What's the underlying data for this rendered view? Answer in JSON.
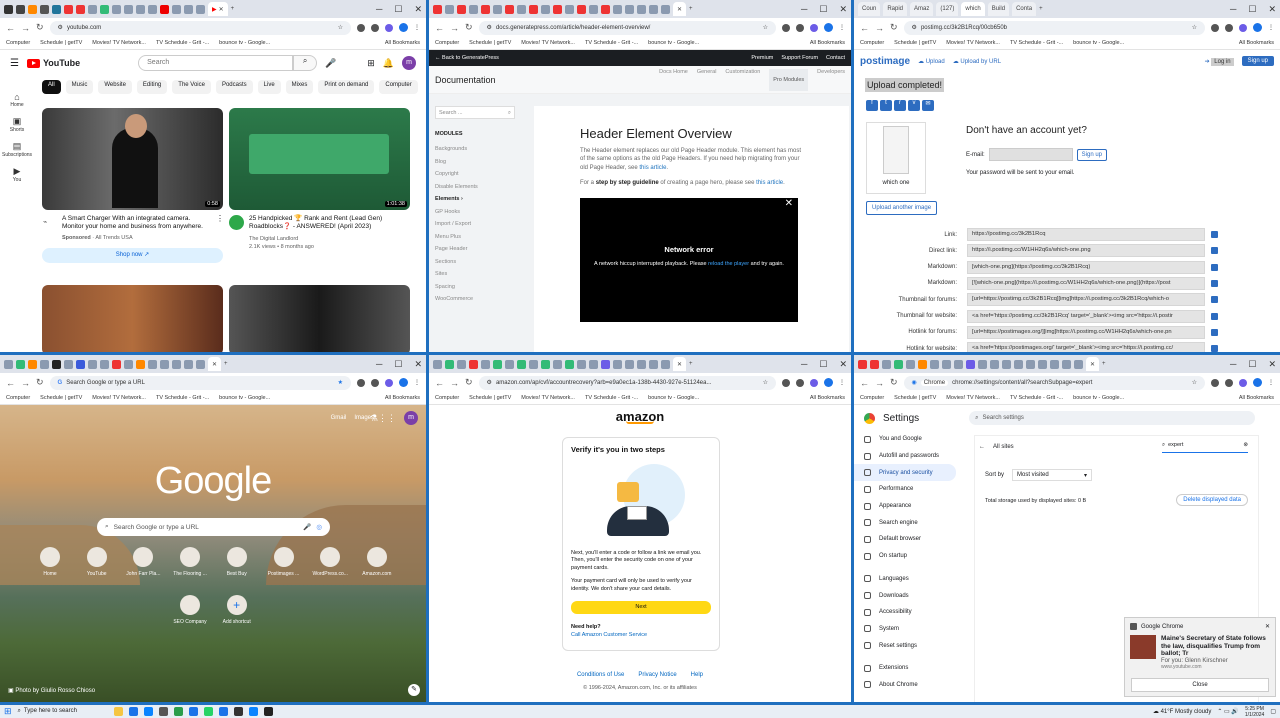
{
  "common": {
    "bookmarks": [
      "Computer",
      "Schedule | getTV",
      "Movies! TV Network...",
      "TV Schedule - Grit -...",
      "bounce tv - Google..."
    ],
    "all_bookmarks": "All Bookmarks"
  },
  "w1": {
    "url": "youtube.com",
    "logo": "YouTube",
    "search_placeholder": "Search",
    "sidebar": [
      "Home",
      "Shorts",
      "Subscriptions",
      "You"
    ],
    "chips": [
      "All",
      "Music",
      "Website",
      "Editing",
      "The Voice",
      "Podcasts",
      "Live",
      "Mixes",
      "Print on demand",
      "Computer"
    ],
    "video1": {
      "title": "A Smart Charger With an integrated camera. Monitor your home and business from anywhere.",
      "sponsored": "Sponsored",
      "channel": "All Trends USA",
      "shop": "Shop now",
      "duration": "0:58"
    },
    "video2": {
      "title": "25 Handpicked 🏆 Rank and Rent (Lead Gen) Roadblocks❓ - ANSWERED! (April 2023)",
      "channel": "The Digital Landlord",
      "meta": "2.1K views • 8 months ago",
      "duration": "1:01:38"
    },
    "avatar": "m"
  },
  "w2": {
    "url": "docs.generatepress.com/article/header-element-overview/",
    "back": "← Back to GeneratePress",
    "top_links": [
      "Premium",
      "Support Forum",
      "Contact"
    ],
    "title": "Documentation",
    "menu": [
      "Docs Home",
      "General",
      "Customization",
      "Pro Modules",
      "Developers"
    ],
    "search_placeholder": "Search ...",
    "modules_heading": "MODULES",
    "modules": [
      "Backgrounds",
      "Blog",
      "Copyright",
      "Disable Elements",
      "Elements ›",
      "GP Hooks",
      "Import / Export",
      "Menu Plus",
      "Page Header",
      "Sections",
      "Sites",
      "Spacing",
      "WooCommerce"
    ],
    "h1": "Header Element Overview",
    "p1": "The Header element replaces our old Page Header module. This element has most of the same options as the old Page Headers. If you need help migrating from your old Page Header, see",
    "p1_link": "this article",
    "p2_pre": "For a",
    "p2_bold": "step by step guideline",
    "p2_mid": "of creating a page hero, please see",
    "p2_link": "this article",
    "player_error": "Network error",
    "player_msg": "A network hiccup interrupted playback. Please",
    "player_link": "reload the player",
    "player_end": "and try again."
  },
  "w3": {
    "url": "postimg.cc/3k2B1Rcq/00cb650b",
    "logo": "postimage",
    "upload": "Upload",
    "upload_url": "Upload by URL",
    "login": "Log in",
    "signup": "Sign up",
    "completed": "Upload completed!",
    "thumb_caption": "which one",
    "upload_another": "Upload another image",
    "no_account": "Don't have an account yet?",
    "email_label": "E-mail:",
    "signup_btn": "Sign up",
    "password_note": "Your password will be sent to your email.",
    "rows": [
      {
        "label": "Link:",
        "value": "https://postimg.cc/3k2B1Rcq"
      },
      {
        "label": "Direct link:",
        "value": "https://i.postimg.cc/W1HH2q6s/which-one.png"
      },
      {
        "label": "Markdown:",
        "value": "[which-one.png](https://postimg.cc/3k2B1Rcq)"
      },
      {
        "label": "Markdown:",
        "value": "[![which-one.png](https://i.postimg.cc/W1HH2q6s/which-one.png)](https://post"
      },
      {
        "label": "Thumbnail for forums:",
        "value": "[url=https://postimg.cc/3k2B1Rcq][img]https://i.postimg.cc/3k2B1Rcq/which-o"
      },
      {
        "label": "Thumbnail for website:",
        "value": "<a href='https://postimg.cc/3k2B1Rcq' target='_blank'><img src='https://i.postir"
      },
      {
        "label": "Hotlink for forums:",
        "value": "[url=https://postimages.org/][img]https://i.postimg.cc/W1HH2q6s/which-one.pn"
      },
      {
        "label": "Hotlink for website:",
        "value": "<a href='https://postimages.org/' target='_blank'><img src='https://i.postimg.cc/"
      }
    ]
  },
  "w4": {
    "url": "Search Google or type a URL",
    "top_links": [
      "Gmail",
      "Images"
    ],
    "logo": "Google",
    "search_placeholder": "Search Google or type a URL",
    "shortcuts": [
      "Home",
      "YouTube",
      "John Farr Pla...",
      "The Flooring ...",
      "Best Buy",
      "Postimages ...",
      "WordPress.co...",
      "Amazon.com",
      "SEO Company",
      "Add shortcut"
    ],
    "photo_credit": "Photo by Giulio Rosso Chioso",
    "avatar": "m"
  },
  "w5": {
    "url": "amazon.com/ap/cvf/accountrecovery?arb=e9a0ec1a-138b-4430-927e-51124ea...",
    "logo": "amazon",
    "heading": "Verify it's you in two steps",
    "p1": "Next, you'll enter a code or follow a link we email you. Then, you'll enter the security code on one of your payment cards.",
    "p2": "Your payment card will only be used to verify your identity. We don't share your card details.",
    "next": "Next",
    "help_q": "Need help?",
    "help_link": "Call Amazon Customer Service",
    "footer_links": [
      "Conditions of Use",
      "Privacy Notice",
      "Help"
    ],
    "copyright": "© 1996-2024, Amazon.com, Inc. or its affiliates"
  },
  "w6": {
    "url": "chrome://settings/content/all?searchSubpage=expert",
    "url_prefix": "Chrome",
    "title": "Settings",
    "search_placeholder": "Search settings",
    "menu": [
      "You and Google",
      "Autofill and passwords",
      "Privacy and security",
      "Performance",
      "Appearance",
      "Search engine",
      "Default browser",
      "On startup",
      "Languages",
      "Downloads",
      "Accessibility",
      "System",
      "Reset settings",
      "Extensions",
      "About Chrome"
    ],
    "all_sites": "All sites",
    "filter": "expert",
    "sort_label": "Sort by",
    "sort_value": "Most visited",
    "storage": "Total storage used by displayed sites: 0 B",
    "delete_btn": "Delete displayed data"
  },
  "notification": {
    "app": "Google Chrome",
    "title": "Maine's Secretary of State follows the law, disqualifies Trump from ballot; Tr",
    "sub": "For you: Glenn Kirschner",
    "site": "www.youtube.com",
    "close": "Close"
  },
  "taskbar": {
    "search": "Type here to search",
    "weather": "41°F  Mostly cloudy",
    "time": "5:25 PM",
    "date": "1/1/2024"
  }
}
